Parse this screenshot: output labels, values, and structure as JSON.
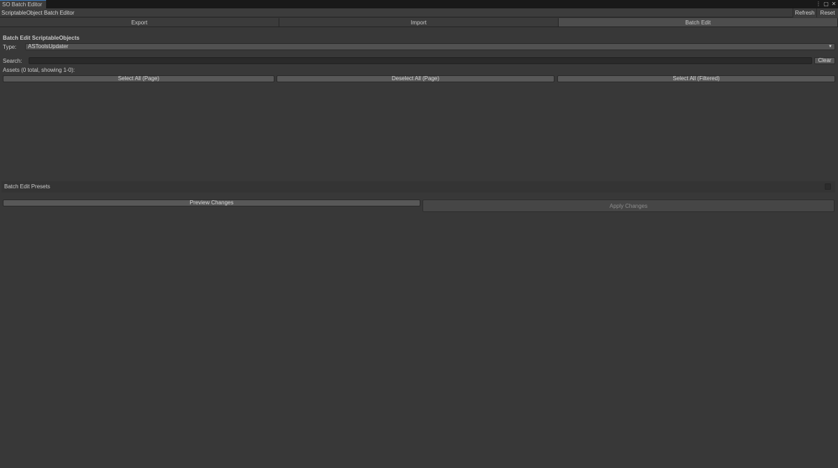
{
  "window": {
    "tab_title": "SO Batch Editor",
    "controls": [
      {
        "name": "more-options-icon",
        "glyph": "⋮"
      },
      {
        "name": "maximize-icon",
        "glyph": "▢"
      },
      {
        "name": "close-icon",
        "glyph": "✕"
      }
    ]
  },
  "header": {
    "title": "ScriptableObject Batch Editor",
    "refresh_label": "Refresh",
    "reset_label": "Reset"
  },
  "tabs": [
    {
      "label": "Export",
      "active": false
    },
    {
      "label": "Import",
      "active": false
    },
    {
      "label": "Batch Edit",
      "active": true
    }
  ],
  "batch_edit": {
    "section_title": "Batch Edit ScriptableObjects",
    "type_label": "Type:",
    "type_value": "ASToolsUpdater",
    "search_label": "Search:",
    "search_value": "",
    "clear_label": "Clear",
    "assets_summary": "Assets (0 total, showing 1-0):",
    "select_all_page_label": "Select All (Page)",
    "deselect_all_page_label": "Deselect All (Page)",
    "select_all_filtered_label": "Select All (Filtered)",
    "presets_label": "Batch Edit Presets",
    "preview_label": "Preview Changes",
    "apply_label": "Apply Changes"
  },
  "colors": {
    "background": "#383838",
    "active_tab": "#4d4d4d",
    "accent": "#3a79bb"
  }
}
